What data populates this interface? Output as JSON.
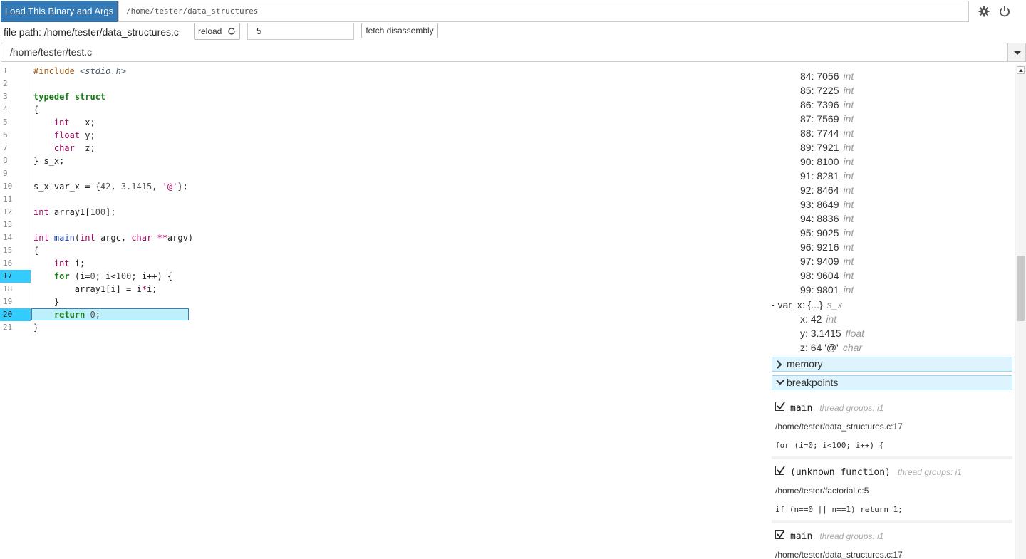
{
  "topbar": {
    "load_button": "Load This Binary and Args",
    "binary_value": "/home/tester/data_structures",
    "settings_icon": "gear-icon",
    "power_icon": "power-icon"
  },
  "toolbar": {
    "file_path": "file path: /home/tester/data_structures.c",
    "reload_label": "reload",
    "line_value": "5",
    "fetch_label": "fetch disassembly"
  },
  "source_select": {
    "value": "/home/tester/test.c"
  },
  "code": {
    "line_numbers": [
      "1",
      "2",
      "3",
      "4",
      "5",
      "6",
      "7",
      "8",
      "9",
      "10",
      "11",
      "12",
      "13",
      "14",
      "15",
      "16",
      "17",
      "18",
      "19",
      "20",
      "21"
    ],
    "breakpoint_lines": [
      17,
      20
    ],
    "current_line": 20
  },
  "right_panel": {
    "array_rows": [
      {
        "label": "84: 7056",
        "type": "int"
      },
      {
        "label": "85: 7225",
        "type": "int"
      },
      {
        "label": "86: 7396",
        "type": "int"
      },
      {
        "label": "87: 7569",
        "type": "int"
      },
      {
        "label": "88: 7744",
        "type": "int"
      },
      {
        "label": "89: 7921",
        "type": "int"
      },
      {
        "label": "90: 8100",
        "type": "int"
      },
      {
        "label": "91: 8281",
        "type": "int"
      },
      {
        "label": "92: 8464",
        "type": "int"
      },
      {
        "label": "93: 8649",
        "type": "int"
      },
      {
        "label": "94: 8836",
        "type": "int"
      },
      {
        "label": "95: 9025",
        "type": "int"
      },
      {
        "label": "96: 9216",
        "type": "int"
      },
      {
        "label": "97: 9409",
        "type": "int"
      },
      {
        "label": "98: 9604",
        "type": "int"
      },
      {
        "label": "99: 9801",
        "type": "int"
      }
    ],
    "var_x": {
      "label": "- var_x: {...}",
      "type": "s_x"
    },
    "var_x_fields": [
      {
        "label": "x: 42",
        "type": "int"
      },
      {
        "label": "y: 3.1415",
        "type": "float"
      },
      {
        "label": "z: 64 '@'",
        "type": "char"
      }
    ],
    "memory_header": "memory",
    "breakpoints_header": "breakpoints",
    "breakpoints": [
      {
        "func": "main",
        "groups": "thread groups: i1",
        "path": "/home/tester/data_structures.c:17",
        "code": "for (i=0; i<100; i++) {"
      },
      {
        "func": "(unknown function)",
        "groups": "thread groups: i1",
        "path": "/home/tester/factorial.c:5",
        "code": "if (n==0 || n==1) return 1;"
      },
      {
        "func": "main",
        "groups": "thread groups: i1",
        "path": "/home/tester/data_structures.c:17",
        "code": ""
      }
    ]
  }
}
